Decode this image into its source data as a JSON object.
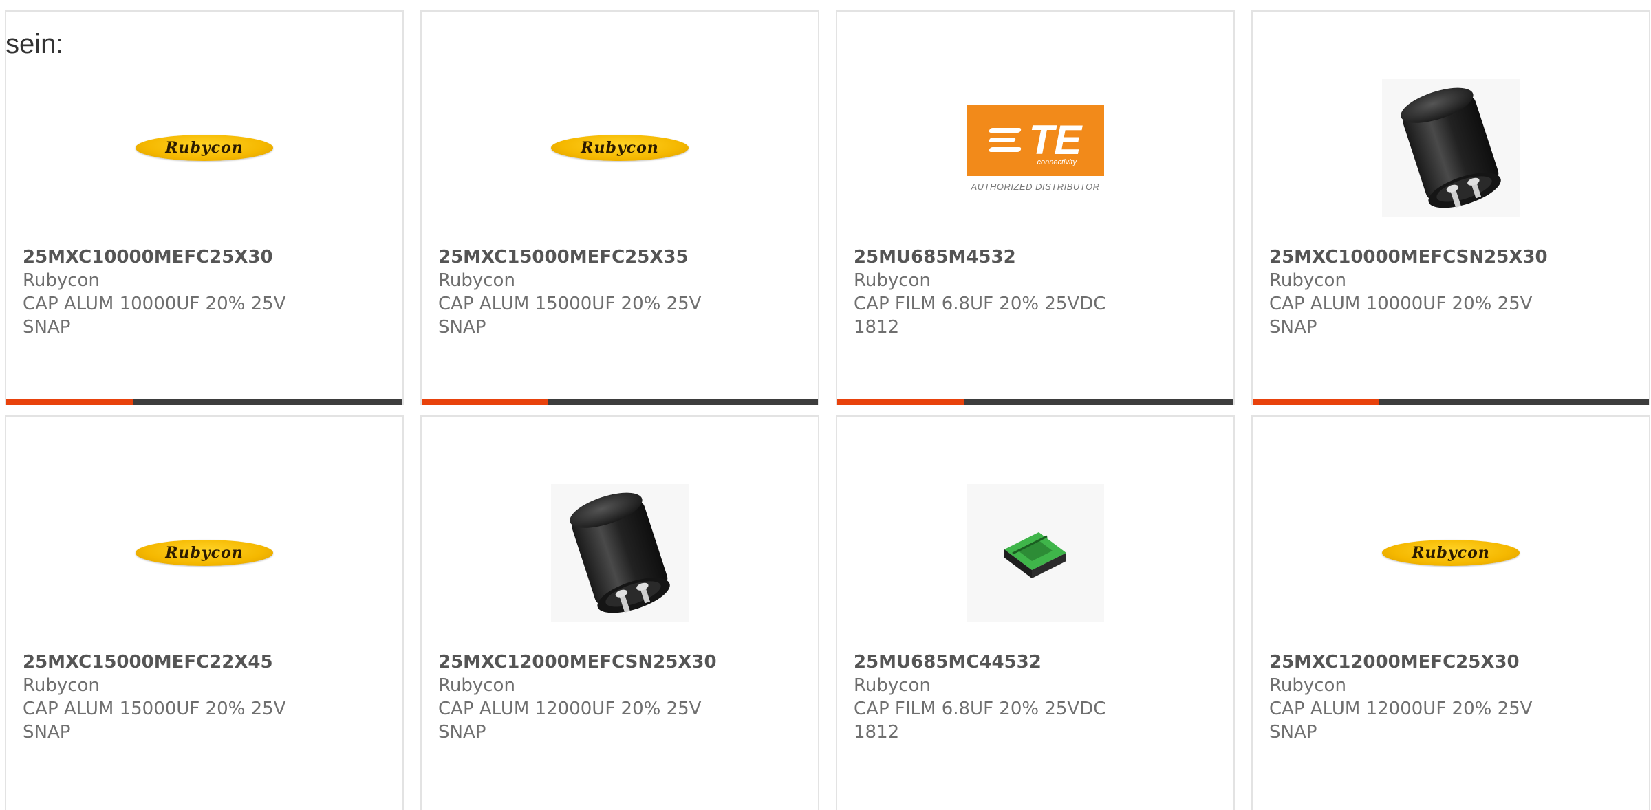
{
  "page": {
    "heading": "sein:"
  },
  "products": [
    {
      "part_number": "25MXC10000MEFC25X30",
      "manufacturer": "Rubycon",
      "description": "CAP ALUM 10000UF 20% 25V SNAP",
      "image": "rubycon-logo",
      "progress": 0.32
    },
    {
      "part_number": "25MXC15000MEFC25X35",
      "manufacturer": "Rubycon",
      "description": "CAP ALUM 15000UF 20% 25V SNAP",
      "image": "rubycon-logo",
      "progress": 0.32
    },
    {
      "part_number": "25MU685M4532",
      "manufacturer": "Rubycon",
      "description": "CAP FILM 6.8UF 20% 25VDC 1812",
      "image": "te-logo",
      "progress": 0.32
    },
    {
      "part_number": "25MXC10000MEFCSN25X30",
      "manufacturer": "Rubycon",
      "description": "CAP ALUM 10000UF 20% 25V SNAP",
      "image": "capacitor-photo",
      "progress": 0.32
    },
    {
      "part_number": "25MXC15000MEFC22X45",
      "manufacturer": "Rubycon",
      "description": "CAP ALUM 15000UF 20% 25V SNAP",
      "image": "rubycon-logo",
      "progress": null
    },
    {
      "part_number": "25MXC12000MEFCSN25X30",
      "manufacturer": "Rubycon",
      "description": "CAP ALUM 12000UF 20% 25V SNAP",
      "image": "capacitor-photo",
      "progress": null
    },
    {
      "part_number": "25MU685MC44532",
      "manufacturer": "Rubycon",
      "description": "CAP FILM 6.8UF 20% 25VDC 1812",
      "image": "film-capacitor-photo",
      "progress": null
    },
    {
      "part_number": "25MXC12000MEFC25X30",
      "manufacturer": "Rubycon",
      "description": "CAP ALUM 12000UF 20% 25V SNAP",
      "image": "rubycon-logo",
      "progress": null
    }
  ],
  "logos": {
    "rubycon_text": "Rubycon",
    "te_letters": "TE",
    "te_sub": "connectivity",
    "te_tagline": "AUTHORIZED DISTRIBUTOR"
  },
  "colors": {
    "accent": "#e8420c",
    "progress_track": "#3d3d3d",
    "card_border": "#e3e3e3",
    "te_orange": "#f28a1a",
    "rubycon_yellow": "#f5b800"
  }
}
